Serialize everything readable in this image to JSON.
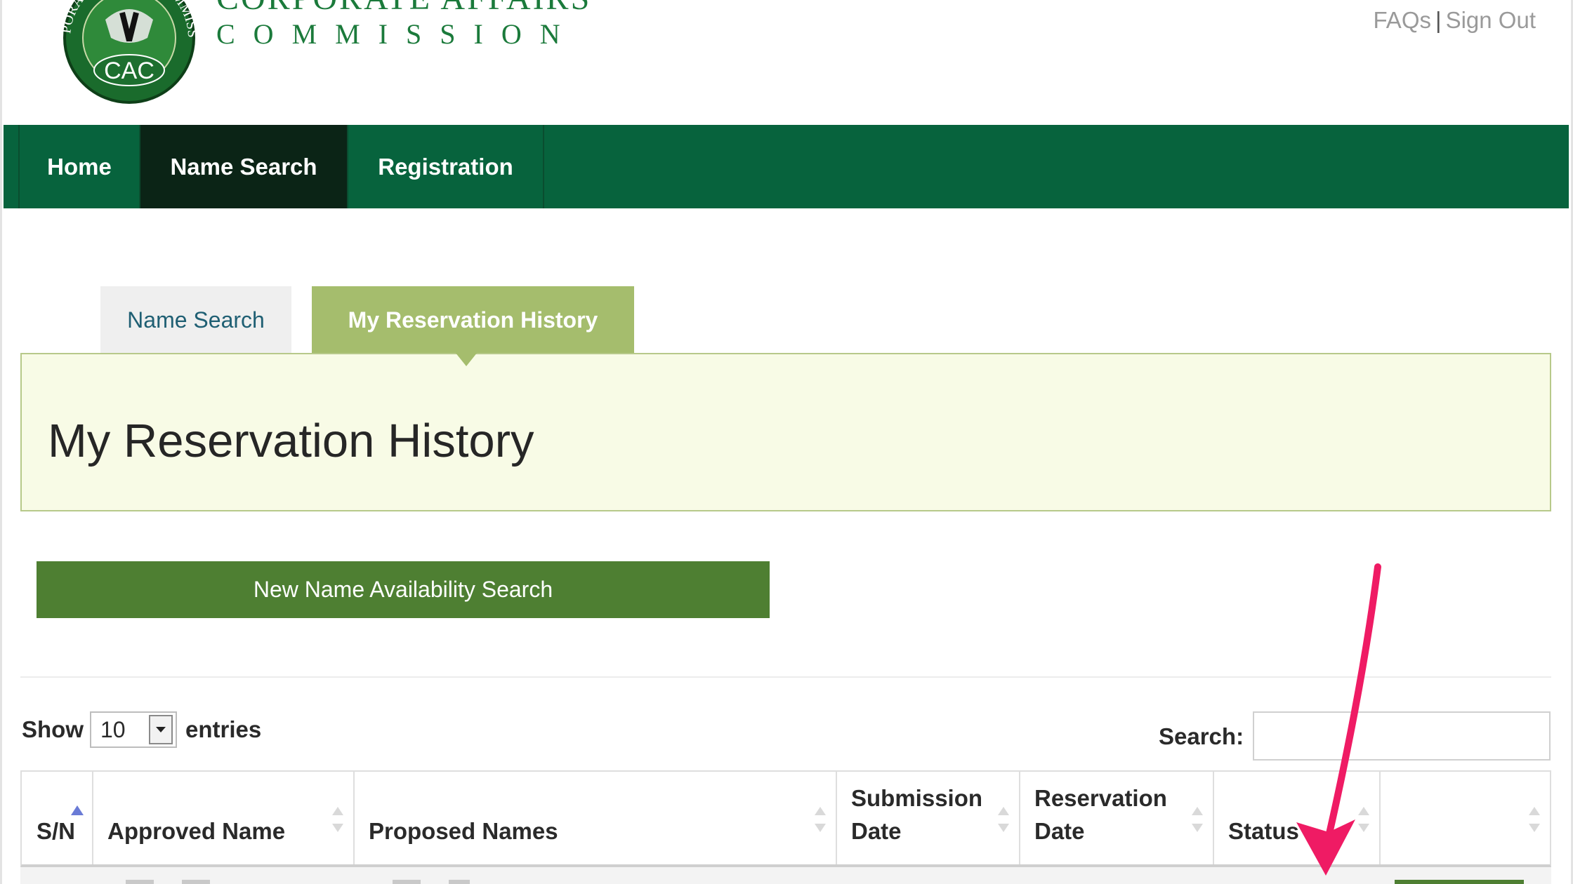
{
  "header": {
    "brand_line1": "CORPORATE AFFAIRS",
    "brand_line2": "COMMISSION",
    "logo_ring_text": "CORPORATE AFFAIRS COMMISSION",
    "logo_center_text": "CAC",
    "top_links": {
      "faqs": "FAQs",
      "separator": "|",
      "sign_out": "Sign Out"
    }
  },
  "main_nav": {
    "items": [
      {
        "label": "Home",
        "active": false
      },
      {
        "label": "Name Search",
        "active": true
      },
      {
        "label": "Registration",
        "active": false
      }
    ]
  },
  "tabs": [
    {
      "label": "Name Search",
      "active": false
    },
    {
      "label": "My Reservation History",
      "active": true
    }
  ],
  "page": {
    "title": "My Reservation History",
    "new_search_button": "New Name Availability Search"
  },
  "table_controls": {
    "show_label": "Show",
    "entries_value": "10",
    "entries_label": "entries",
    "search_label": "Search:",
    "search_value": ""
  },
  "table": {
    "columns": [
      {
        "line1": "S/N",
        "line2": "",
        "sorted": "ascending"
      },
      {
        "line1": "Approved Name",
        "line2": ""
      },
      {
        "line1": "Proposed Names",
        "line2": ""
      },
      {
        "line1": "Submission",
        "line2": "Date"
      },
      {
        "line1": "Reservation",
        "line2": "Date"
      },
      {
        "line1": "Status",
        "line2": ""
      },
      {
        "line1": "",
        "line2": ""
      }
    ]
  },
  "colors": {
    "nav_green": "#07633d",
    "nav_active": "#0b2416",
    "tab_active": "#a5bd6d",
    "button_green": "#4e7f32",
    "panel_bg": "#f8fbe6",
    "arrow_pink": "#ef1b64"
  }
}
